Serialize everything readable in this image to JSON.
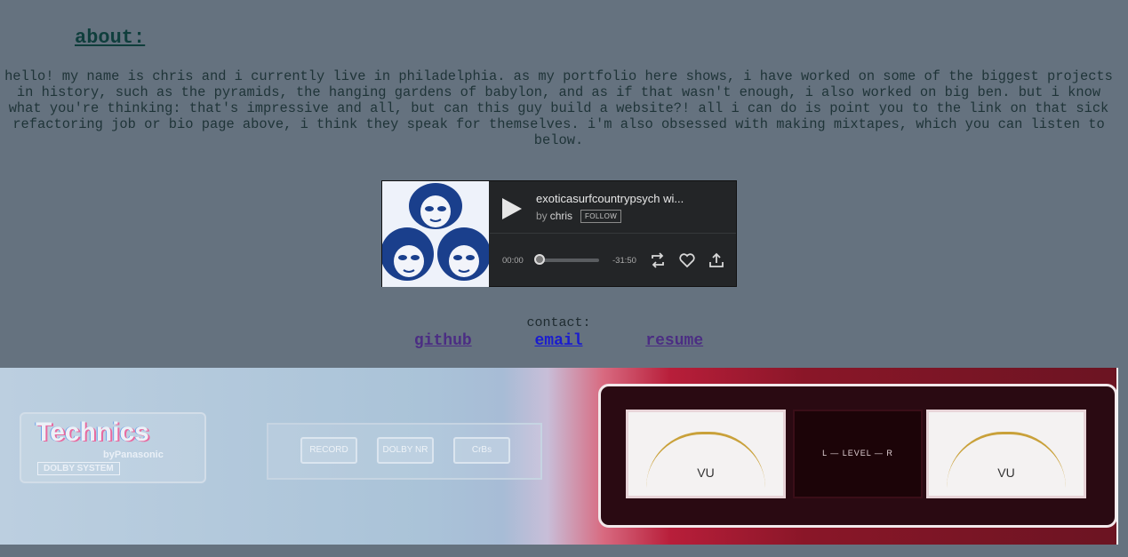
{
  "about": {
    "heading": "about:",
    "bio": "hello! my name is chris and i currently live in philadelphia. as my portfolio here shows, i have worked on some of the biggest projects in history, such as the pyramids, the hanging gardens of babylon, and as if that wasn't enough, i also worked on big ben. but i know what you're thinking: that's impressive and all, but can this guy build a website?! all i can do is point you to the link on that sick refactoring job or bio page above, i think they speak for themselves. i'm also obsessed with making mixtapes, which you can listen to below."
  },
  "player": {
    "title": "exoticasurfcountrypsych wi...",
    "by": "by",
    "artist": "chris",
    "follow_label": "FOLLOW",
    "time_current": "00:00",
    "time_remaining": "-31:50",
    "progress": 0,
    "icons": [
      "play-icon",
      "repost-icon",
      "heart-icon",
      "share-icon"
    ]
  },
  "contact": {
    "label": "contact:",
    "links": {
      "github": "github",
      "email": "email",
      "resume": "resume"
    }
  },
  "banner": {
    "brand": "Technics",
    "brand_sub": "byPanasonic",
    "dolby": "DOLBY SYSTEM",
    "buttons": [
      "RECORD",
      "DOLBY NR",
      "CrBs"
    ],
    "level_text": "L — LEVEL — R",
    "meter_label": "VU"
  },
  "colors": {
    "background": "#65727f",
    "heading": "#0f3e3c",
    "link_visited": "#4b2d83",
    "link": "#1a1ccf",
    "player_bg": "#232527"
  }
}
